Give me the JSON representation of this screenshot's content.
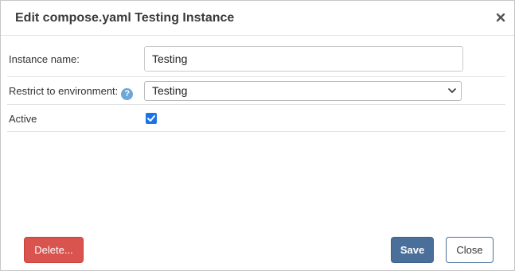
{
  "dialog": {
    "title": "Edit compose.yaml Testing Instance"
  },
  "form": {
    "instance_name": {
      "label": "Instance name:",
      "value": "Testing"
    },
    "environment": {
      "label": "Restrict to environment:",
      "help_icon": "question-mark-icon",
      "selected": "Testing"
    },
    "active": {
      "label": "Active",
      "checked": true
    }
  },
  "buttons": {
    "delete_label": "Delete...",
    "save_label": "Save",
    "close_label": "Close"
  },
  "colors": {
    "delete": "#d9534f",
    "save": "#4a6f9b",
    "checkbox": "#1a73e8",
    "help_icon": "#6ea6d6"
  }
}
